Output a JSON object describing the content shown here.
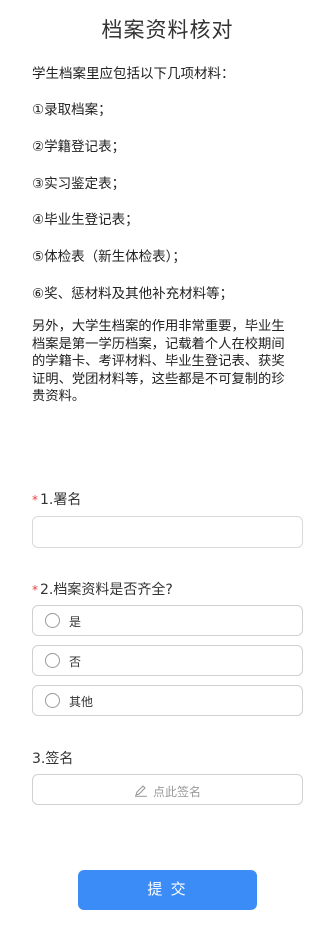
{
  "page": {
    "title": "档案资料核对"
  },
  "intro": {
    "lead": "学生档案里应包括以下几项材料：",
    "items": [
      "①录取档案；",
      "②学籍登记表；",
      "③实习鉴定表；",
      "④毕业生登记表；",
      "⑤体检表（新生体检表）；",
      "⑥奖、惩材料及其他补充材料等；"
    ],
    "paragraph": "另外，大学生档案的作用非常重要，毕业生档案是第一学历档案，记载着个人在校期间的学籍卡、考评材料、毕业生登记表、获奖证明、党团材料等，这些都是不可复制的珍贵资料。"
  },
  "form": {
    "q1": {
      "required_mark": "*",
      "label": "1.署名",
      "value": ""
    },
    "q2": {
      "required_mark": "*",
      "label": "2.档案资料是否齐全?",
      "options": [
        "是",
        "否",
        "其他"
      ]
    },
    "q3": {
      "label": "3.签名",
      "placeholder": "点此签名"
    },
    "submit_label": "提 交"
  },
  "colors": {
    "required": "#e64340",
    "submit": "#3c8cf8"
  },
  "icons": {
    "sign": "pen-icon",
    "radio": "radio-circle"
  }
}
